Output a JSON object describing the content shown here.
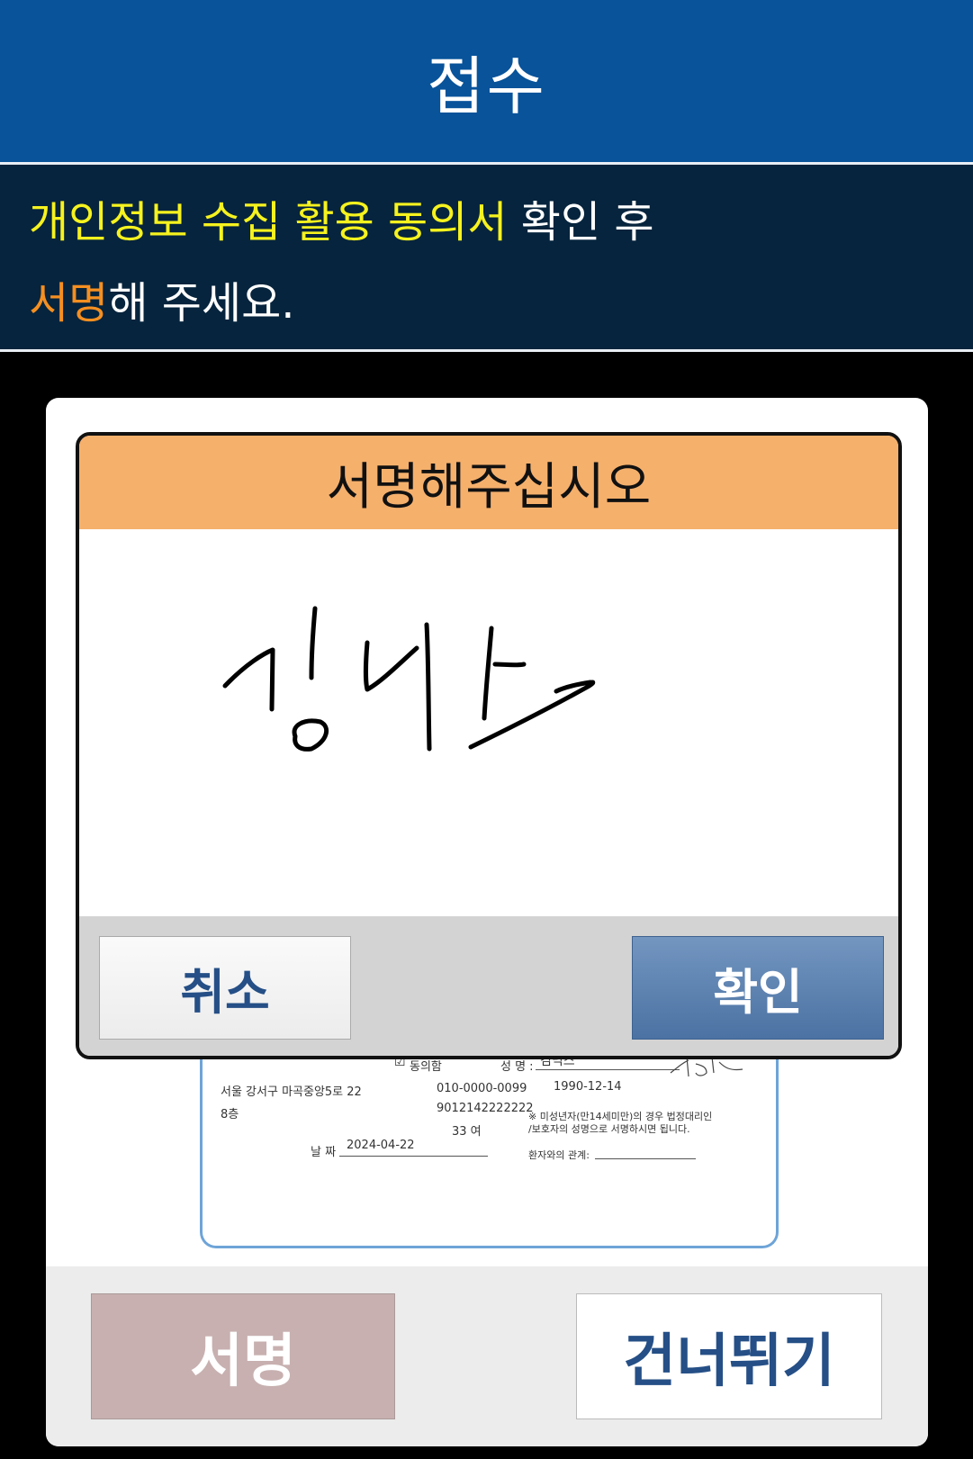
{
  "header": {
    "title": "접수"
  },
  "instruction": {
    "line1_highlight": "개인정보 수집 활용 동의서",
    "line1_rest": " 확인 후",
    "line2_highlight": "서명",
    "line2_rest": "해 주세요."
  },
  "document": {
    "agree": "동의함",
    "name_label": "성 명 :",
    "name_value": "김닉스",
    "address_line1": "서울 강서구 마곡중앙5로 22",
    "address_line2": "8층",
    "phone": "010-0000-0099",
    "birth": "1990-12-14",
    "id_number": "9012142222222",
    "age_gender": "33 여",
    "minor_note_line1": "※ 미성년자(만14세미만)의  경우 법정대리인",
    "minor_note_line2": "/보호자의 성명으로 서명하시면 됩니다.",
    "date_label": "날 짜",
    "date_value": "2024-04-22",
    "relation_label": "환자와의 관계:"
  },
  "buttons": {
    "sign": "서명",
    "skip": "건너뛰기"
  },
  "dialog": {
    "title": "서명해주십시오",
    "cancel": "취소",
    "confirm": "확인"
  },
  "colors": {
    "header_bg": "#08539a",
    "instruction_bg": "#06243d",
    "highlight_yellow": "#f6f21e",
    "highlight_orange": "#f58f21",
    "dialog_header": "#f5b06c",
    "confirm_button": "#5a80b0",
    "sign_button": "#c8b0b0"
  },
  "icons": {
    "checkbox": "checkbox-checked-icon"
  }
}
